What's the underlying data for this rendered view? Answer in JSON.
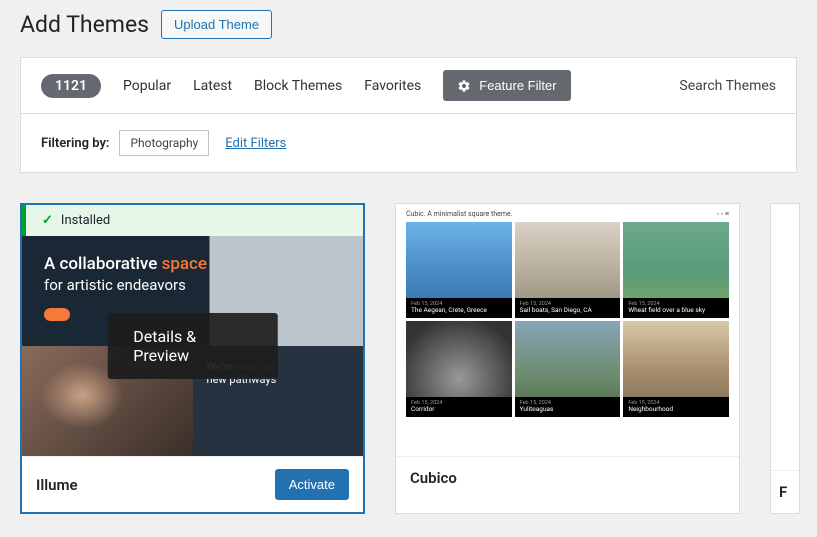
{
  "header": {
    "title": "Add Themes",
    "upload_label": "Upload Theme"
  },
  "filter_bar": {
    "count": "1121",
    "links": [
      "Popular",
      "Latest",
      "Block Themes",
      "Favorites"
    ],
    "feature_filter_label": "Feature Filter",
    "search_label": "Search Themes"
  },
  "filtering": {
    "label": "Filtering by:",
    "tag": "Photography",
    "edit_label": "Edit Filters"
  },
  "themes": {
    "illume": {
      "installed_label": "Installed",
      "title_a": "A collaborative",
      "title_b": "space",
      "subtitle": "for artistic endeavors",
      "creating_a": "We're",
      "creating_b": "creating",
      "creating_c": "new pathways",
      "details_label": "Details & Preview",
      "name": "Illume",
      "activate_label": "Activate"
    },
    "cubico": {
      "name": "Cubico",
      "caption": "Cubic. A minimalist square theme.",
      "tiles": [
        {
          "date": "Feb 15, 2024",
          "title": "The Aegean, Crete, Greece"
        },
        {
          "date": "Feb 15, 2024",
          "title": "Sail boats, San Diego, CA"
        },
        {
          "date": "Feb 15, 2024",
          "title": "Wheat field over a blue sky"
        },
        {
          "date": "Feb 15, 2024",
          "title": "Corridor"
        },
        {
          "date": "Feb 15, 2024",
          "title": "Yuliteaguas"
        },
        {
          "date": "Feb 15, 2024",
          "title": "Neighbourhood"
        }
      ]
    }
  }
}
